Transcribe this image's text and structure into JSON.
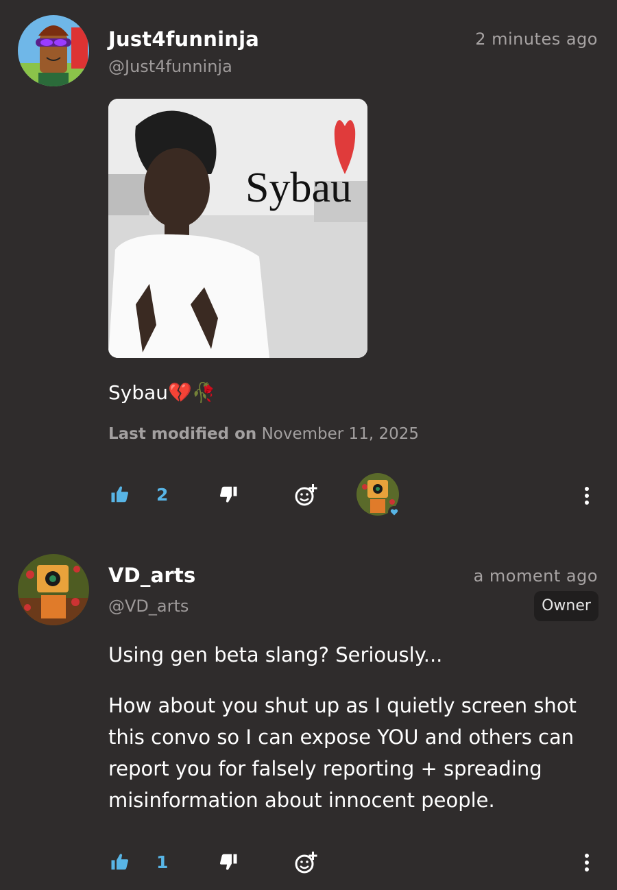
{
  "comments": [
    {
      "username": "Just4funninja",
      "handle": "@Just4funninja",
      "time": "2 minutes ago",
      "image_text": "Sybau",
      "text": "Sybau💔🥀",
      "modified_label": "Last modified on",
      "modified_date": "November 11, 2025",
      "likes": "2"
    },
    {
      "username": "VD_arts",
      "handle": "@VD_arts",
      "time": "a moment ago",
      "badge": "Owner",
      "paragraph1": "Using gen beta slang? Seriously...",
      "paragraph2": "How about you shut up as I quietly screen shot this convo so I can expose YOU and others can report you for falsely reporting + spreading misinformation about innocent people.",
      "likes": "1"
    }
  ],
  "colors": {
    "background": "#2f2c2c",
    "accent": "#58b5e6",
    "muted": "#a7a3a3"
  },
  "icons": [
    "thumbs-up-icon",
    "thumbs-down-icon",
    "add-reaction-icon",
    "more-options-icon",
    "heart-icon"
  ]
}
